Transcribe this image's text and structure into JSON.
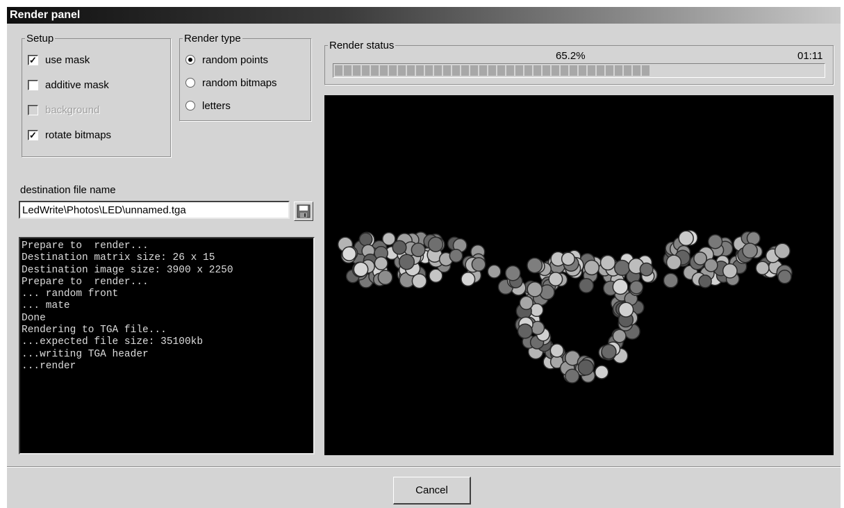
{
  "window": {
    "title": "Render panel"
  },
  "setup": {
    "legend": "Setup",
    "options": [
      {
        "label": "use mask",
        "checked": true,
        "disabled": false
      },
      {
        "label": "additive mask",
        "checked": false,
        "disabled": false
      },
      {
        "label": "background",
        "checked": false,
        "disabled": true
      },
      {
        "label": "rotate bitmaps",
        "checked": true,
        "disabled": false
      }
    ]
  },
  "render_type": {
    "legend": "Render type",
    "options": [
      {
        "label": "random points",
        "selected": true
      },
      {
        "label": "random bitmaps",
        "selected": false
      },
      {
        "label": "letters",
        "selected": false
      }
    ]
  },
  "destination": {
    "label": "destination file name",
    "value": "LedWrite\\Photos\\LED\\unnamed.tga",
    "save_icon": "floppy-disk-icon"
  },
  "log": {
    "lines": [
      "Prepare to  render...",
      "Destination matrix size: 26 x 15",
      "Destination image size: 3900 x 2250",
      "Prepare to  render...",
      "... random front",
      "... mate",
      "Done",
      "Rendering to TGA file...",
      "...expected file size: 35100kb",
      "...writing TGA header",
      "...render"
    ]
  },
  "render_status": {
    "legend": "Render status",
    "percent_text": "65.2%",
    "progress": 0.652,
    "elapsed": "01:11"
  },
  "preview": {
    "icon": "render-preview-image"
  },
  "cancel_label": "Cancel",
  "colors": {
    "window_bg": "#d4d4d4",
    "progress_block": "#a8a8a8",
    "log_bg": "#000000",
    "log_text": "#dcdcdc",
    "preview_bg": "#000000",
    "dot_fill": "#7a7a7a"
  }
}
